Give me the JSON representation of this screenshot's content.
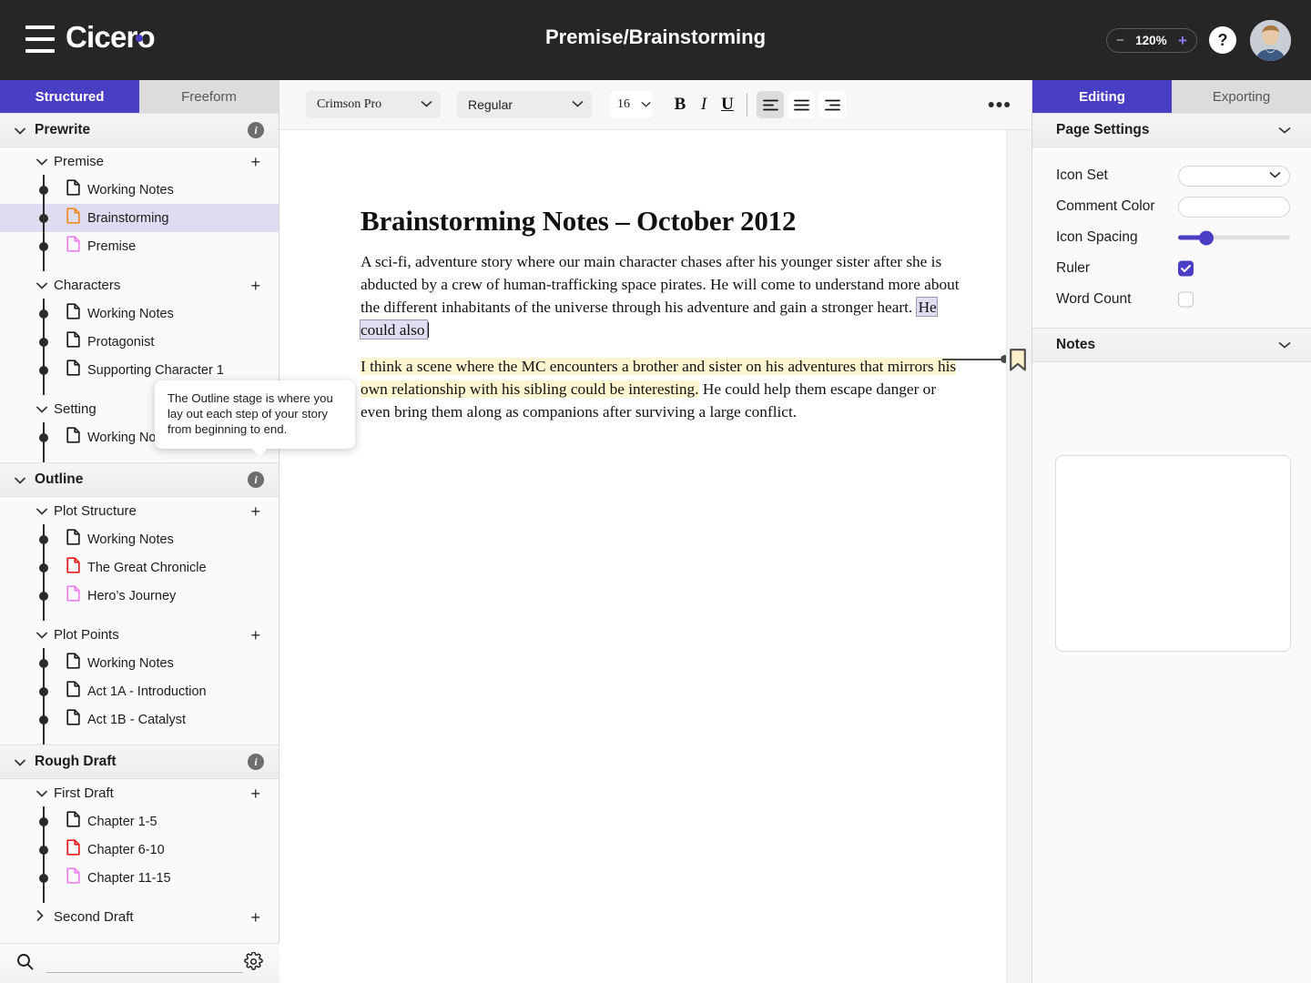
{
  "header": {
    "brand": "Cicero",
    "title": "Premise/Brainstorming",
    "menu_icon": "hamburger-icon",
    "zoom": {
      "value": "120%",
      "minus": "−",
      "plus": "+"
    },
    "help": "?",
    "accent_color": "#4a3fc4",
    "bar_color": "#262626"
  },
  "sidebar": {
    "tabs": [
      {
        "label": "Structured",
        "active": true
      },
      {
        "label": "Freeform",
        "active": false
      }
    ],
    "stages": [
      {
        "label": "Prewrite",
        "info": "i",
        "groups": [
          {
            "label": "Premise",
            "add": "+",
            "expanded": true,
            "docs": [
              {
                "label": "Working Notes",
                "color": "#1c1c1c",
                "selected": false
              },
              {
                "label": "Brainstorming",
                "color": "#f08a24",
                "selected": true
              },
              {
                "label": "Premise",
                "color": "#f07ef0",
                "selected": false
              }
            ]
          },
          {
            "label": "Characters",
            "add": "+",
            "expanded": true,
            "docs": [
              {
                "label": "Working Notes",
                "color": "#1c1c1c",
                "selected": false
              },
              {
                "label": "Protagonist",
                "color": "#1c1c1c",
                "selected": false
              },
              {
                "label": "Supporting Character 1",
                "color": "#1c1c1c",
                "selected": false
              }
            ]
          },
          {
            "label": "Setting",
            "add": "",
            "expanded": true,
            "docs": [
              {
                "label": "Working Notes",
                "color": "#1c1c1c",
                "selected": false
              }
            ]
          }
        ]
      },
      {
        "label": "Outline",
        "info": "i",
        "groups": [
          {
            "label": "Plot Structure",
            "add": "+",
            "expanded": true,
            "docs": [
              {
                "label": "Working Notes",
                "color": "#1c1c1c",
                "selected": false
              },
              {
                "label": "The Great Chronicle",
                "color": "#ee1b1b",
                "selected": false
              },
              {
                "label": "Hero’s Journey",
                "color": "#f07ef0",
                "selected": false
              }
            ]
          },
          {
            "label": "Plot Points",
            "add": "+",
            "expanded": true,
            "docs": [
              {
                "label": "Working Notes",
                "color": "#1c1c1c",
                "selected": false
              },
              {
                "label": "Act 1A - Introduction",
                "color": "#1c1c1c",
                "selected": false
              },
              {
                "label": "Act 1B - Catalyst",
                "color": "#1c1c1c",
                "selected": false
              }
            ]
          }
        ]
      },
      {
        "label": "Rough Draft",
        "info": "i",
        "groups": [
          {
            "label": "First Draft",
            "add": "+",
            "expanded": true,
            "docs": [
              {
                "label": "Chapter 1-5",
                "color": "#1c1c1c",
                "selected": false
              },
              {
                "label": "Chapter 6-10",
                "color": "#ee1b1b",
                "selected": false
              },
              {
                "label": "Chapter 11-15",
                "color": "#f07ef0",
                "selected": false
              }
            ]
          },
          {
            "label": "Second Draft",
            "add": "+",
            "expanded": false,
            "docs": []
          }
        ]
      }
    ],
    "search": {
      "placeholder": "",
      "value": "",
      "icon": "search-icon"
    },
    "settings_icon": "gear-icon"
  },
  "tooltip": {
    "text": "The Outline stage is where you lay out each step of your story from beginning to end."
  },
  "toolbar": {
    "font_family": "Crimson Pro",
    "font_style": "Regular",
    "font_size": "16",
    "bold": "B",
    "italic": "I",
    "underline": "U",
    "align_left": "align-left",
    "align_center": "align-center",
    "align_right": "align-right",
    "active_align": "align-left",
    "overflow": "•••"
  },
  "document": {
    "title": "Brainstorming Notes – October 2012",
    "paragraph1": {
      "before": "A sci-fi, adventure story where our main character chases after his younger sister after she is abducted by a crew of human-trafficking space pirates. He will come to understand more about the different inhabitants of the universe through his adventure and gain a stronger heart. ",
      "selected": "He could also"
    },
    "paragraph2": {
      "highlighted": "I think a scene where the MC encounters a brother and sister on his adventures that mirrors his own relationship with his sibling could be interesting.",
      "rest": " He could help them escape danger or even bring them along as companions after surviving a large conflict."
    },
    "highlight_color": "#fdf5cf",
    "selection_color": "#dfdef0",
    "bookmark_icon": "bookmark-icon"
  },
  "rightpanel": {
    "tabs": [
      {
        "label": "Editing",
        "active": true
      },
      {
        "label": "Exporting",
        "active": false
      }
    ],
    "page_settings": {
      "label": "Page Settings",
      "rows": [
        {
          "label": "Icon Set",
          "type": "select",
          "value": ""
        },
        {
          "label": "Comment Color",
          "type": "color",
          "value": ""
        },
        {
          "label": "Icon Spacing",
          "type": "slider",
          "value": 20
        },
        {
          "label": "Ruler",
          "type": "checkbox",
          "value": true
        },
        {
          "label": "Word Count",
          "type": "checkbox",
          "value": false
        }
      ]
    },
    "notes": {
      "label": "Notes",
      "value": "",
      "placeholder": ""
    }
  }
}
